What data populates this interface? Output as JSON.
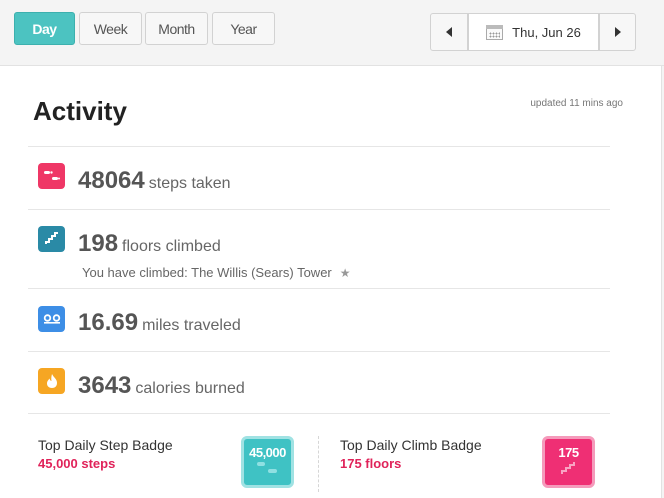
{
  "toolbar": {
    "segments": [
      {
        "label": "Day",
        "active": true
      },
      {
        "label": "Week",
        "active": false
      },
      {
        "label": "Month",
        "active": false
      },
      {
        "label": "Year",
        "active": false
      }
    ],
    "date": "Thu, Jun 26"
  },
  "activity": {
    "title": "Activity",
    "updated": "updated 11 mins ago",
    "steps": {
      "value": "48064",
      "unit": "steps taken",
      "icon": "footsteps-icon",
      "color": "#ef3766"
    },
    "floors": {
      "value": "198",
      "unit": "floors climbed",
      "note": "You have climbed: The Willis (Sears) Tower",
      "icon": "stairs-icon",
      "color": "#2a8aa6"
    },
    "miles": {
      "value": "16.69",
      "unit": "miles traveled",
      "icon": "distance-icon",
      "color": "#3d8ee6"
    },
    "calories": {
      "value": "3643",
      "unit": "calories burned",
      "icon": "flame-icon",
      "color": "#f6a623"
    }
  },
  "badges": {
    "step": {
      "label": "Top Daily Step Badge",
      "value": "45,000 steps",
      "badge_text": "45,000",
      "color": "#3fc2c4"
    },
    "climb": {
      "label": "Top Daily Climb Badge",
      "value": "175 floors",
      "badge_text": "175",
      "color": "#ef2f74"
    }
  }
}
